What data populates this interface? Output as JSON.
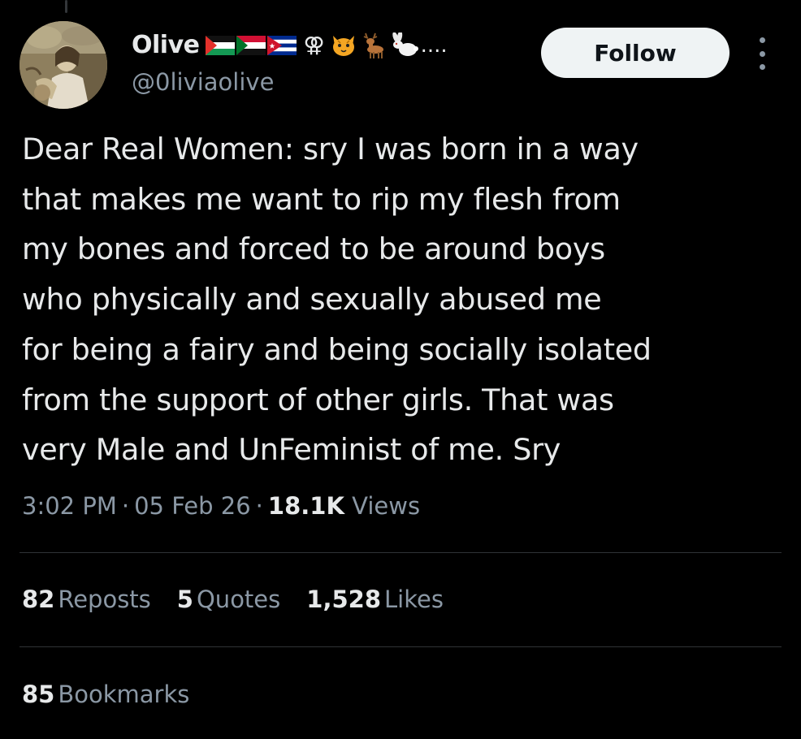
{
  "author": {
    "display_name": "Olive",
    "handle": "@0liviaolive",
    "name_emojis": [
      "palestine-flag",
      "sudan-flag",
      "cuba-flag",
      "sapphic-symbol",
      "cat-face",
      "deer",
      "rabbit"
    ],
    "symbol_text": "⚢",
    "truncation": "...."
  },
  "actions": {
    "follow_label": "Follow"
  },
  "tweet": {
    "text_lines": [
      "Dear Real Women: sry I was born in a way",
      "that makes me want to rip my flesh from",
      "my bones and forced to be around boys",
      "who physically and sexually abused me",
      "for being a fairy and being socially isolated",
      "from the support of other girls. That was",
      "very Male and UnFeminist of me. Sry"
    ],
    "time": "3:02 PM",
    "date": "05 Feb 26",
    "separator": "·",
    "views_count": "18.1K",
    "views_label": "Views"
  },
  "stats": [
    {
      "count": "82",
      "label": "Reposts"
    },
    {
      "count": "5",
      "label": "Quotes"
    },
    {
      "count": "1,528",
      "label": "Likes"
    }
  ],
  "bookmarks": {
    "count": "85",
    "label": "Bookmarks"
  },
  "colors": {
    "background": "#000000",
    "text_primary": "#e7e9ea",
    "text_secondary": "#8b98a5",
    "divider": "#2f3336",
    "follow_bg": "#eff3f4",
    "follow_text": "#0f1419"
  }
}
